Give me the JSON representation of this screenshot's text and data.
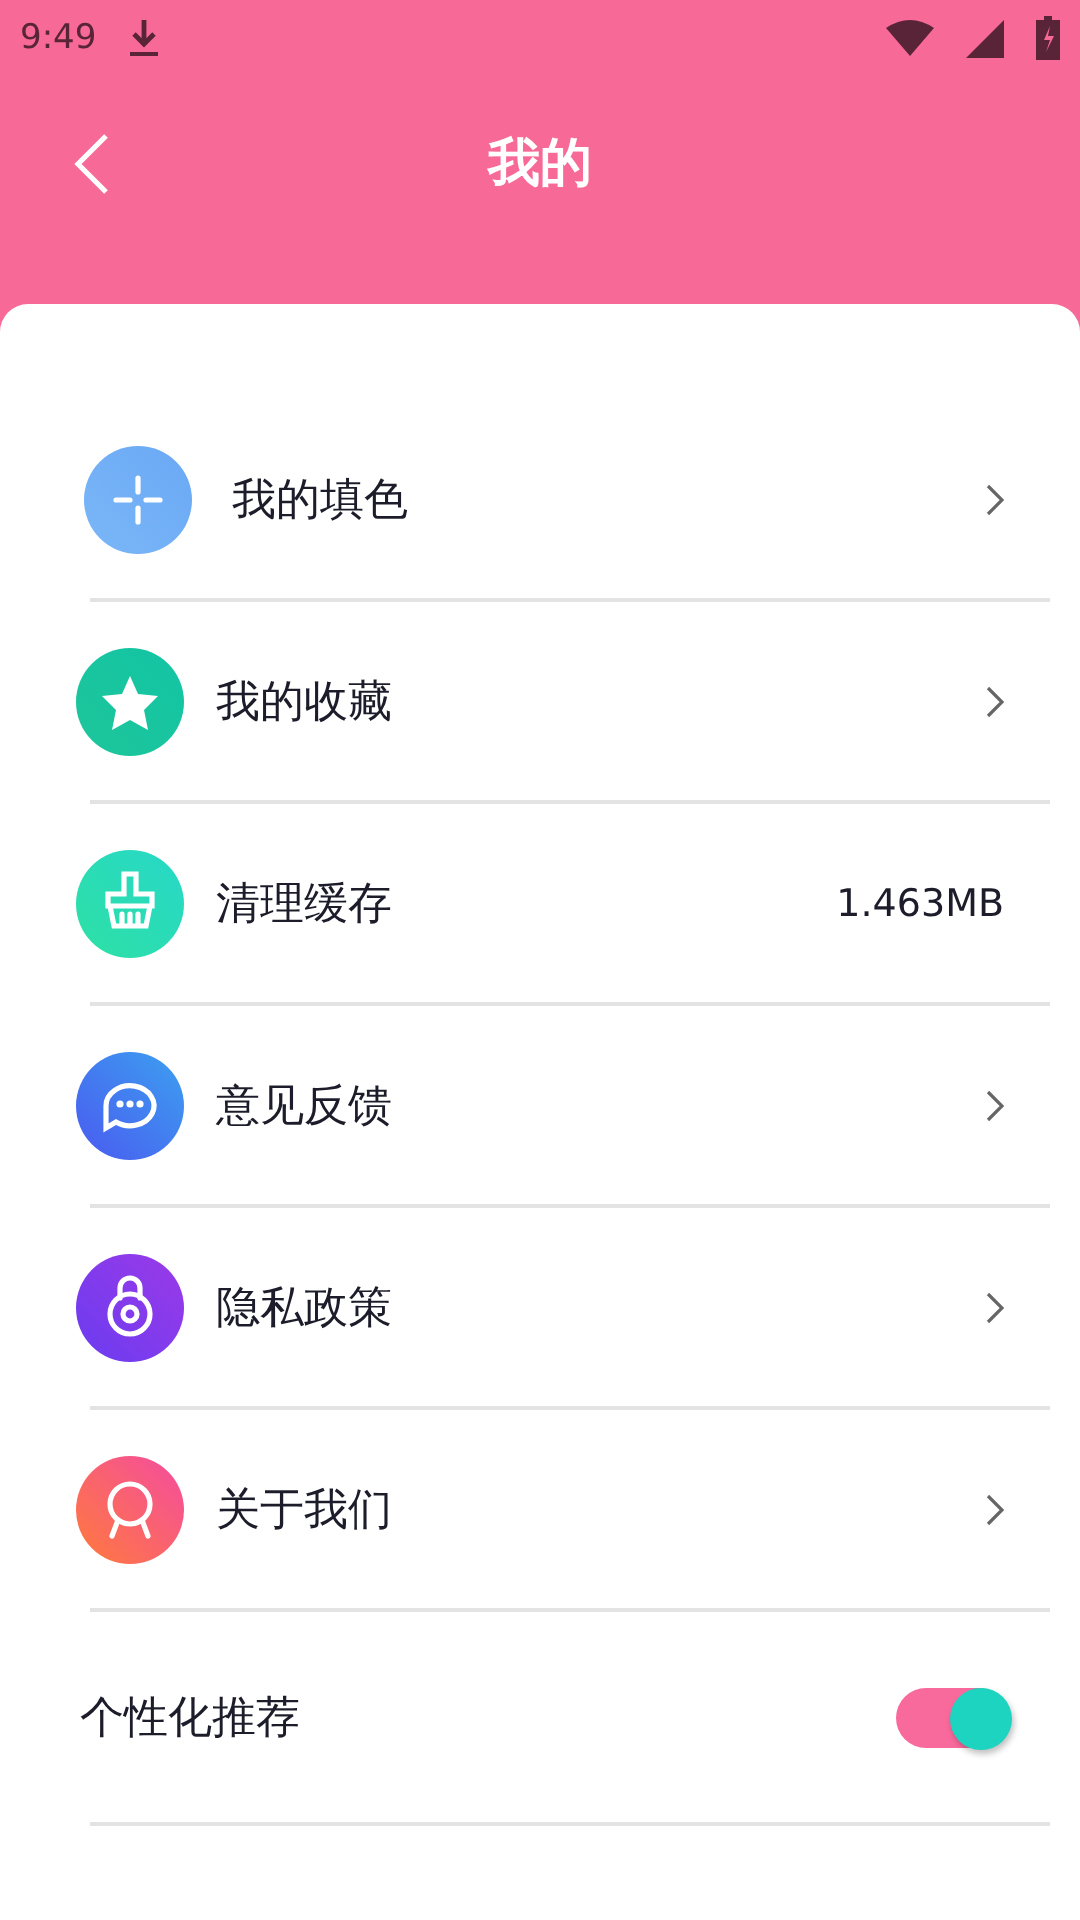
{
  "status_bar": {
    "time": "9:49"
  },
  "header": {
    "title": "我的"
  },
  "menu": [
    {
      "kind": "link",
      "label": "我的填色"
    },
    {
      "kind": "link",
      "label": "我的收藏"
    },
    {
      "kind": "value",
      "label": "清理缓存",
      "value": "1.463MB"
    },
    {
      "kind": "link",
      "label": "意见反馈"
    },
    {
      "kind": "link",
      "label": "隐私政策"
    },
    {
      "kind": "link",
      "label": "关于我们"
    }
  ],
  "recommend": {
    "label": "个性化推荐",
    "on": true
  }
}
